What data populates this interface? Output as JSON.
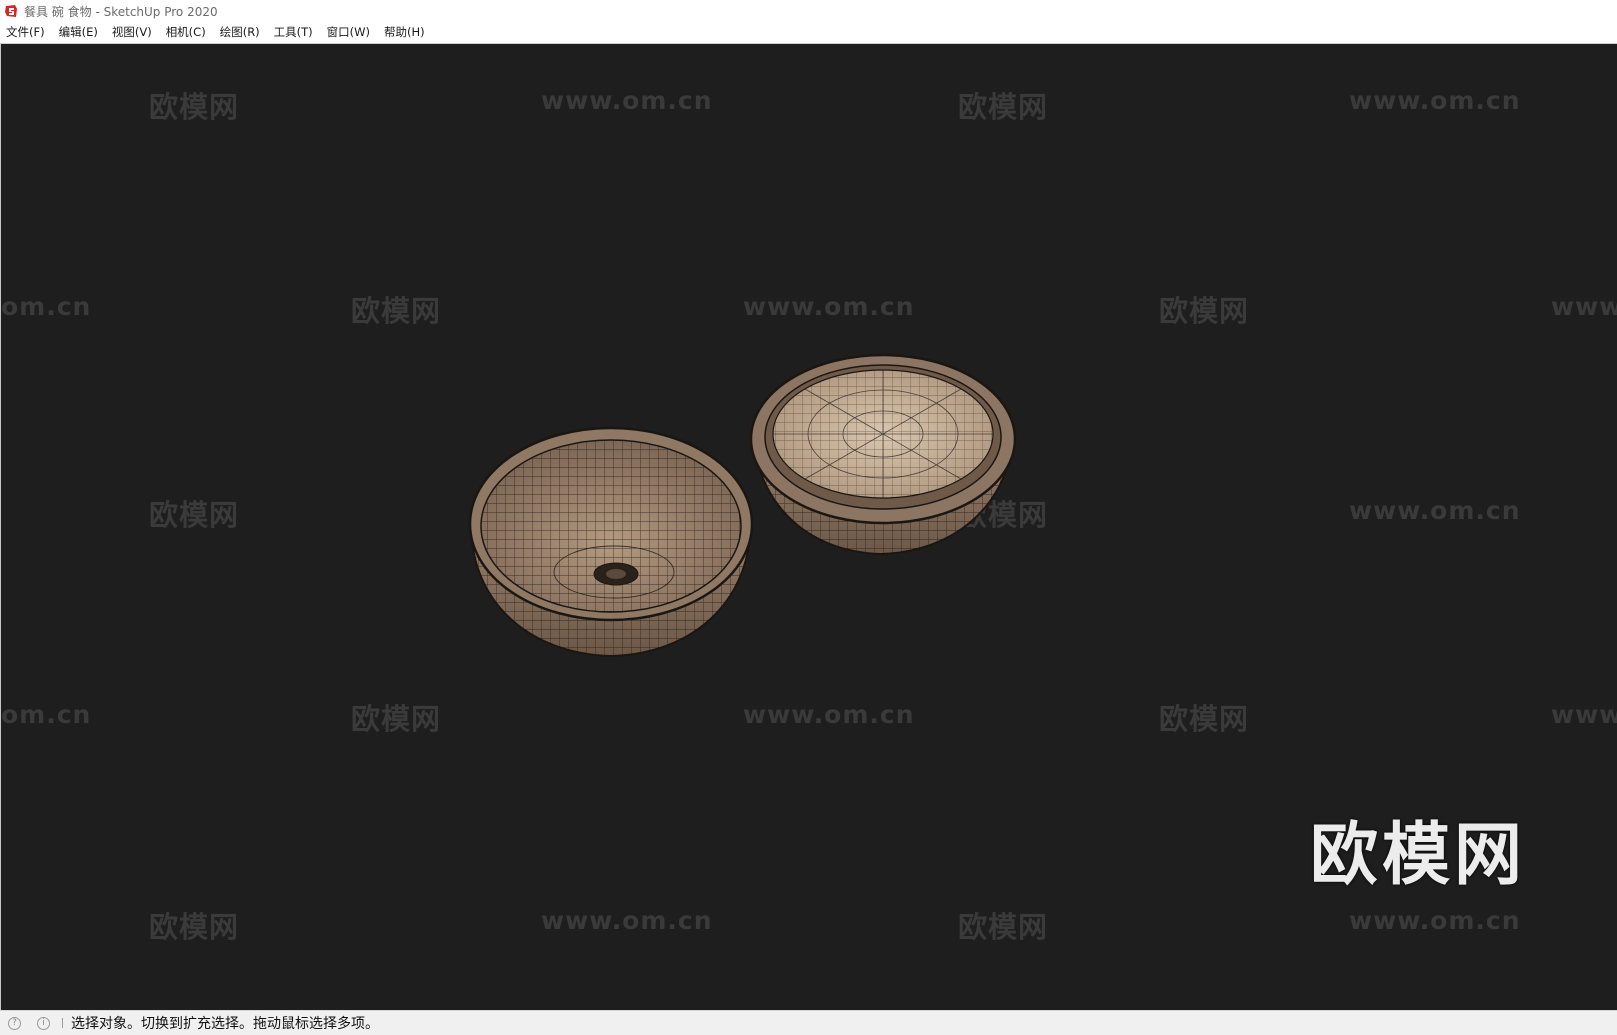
{
  "window": {
    "title": "餐具 碗 食物 - SketchUp Pro 2020",
    "app_icon": "sketchup-logo-icon"
  },
  "menu": [
    {
      "label": "文件(F)"
    },
    {
      "label": "编辑(E)"
    },
    {
      "label": "视图(V)"
    },
    {
      "label": "相机(C)"
    },
    {
      "label": "绘图(R)"
    },
    {
      "label": "工具(T)"
    },
    {
      "label": "窗口(W)"
    },
    {
      "label": "帮助(H)"
    }
  ],
  "viewport": {
    "background": "#1e1e1e",
    "scene": "two wireframe bowls, one empty, one containing food",
    "watermark_cn": "欧模网",
    "watermark_url": "www.om.cn",
    "watermark_om_cn": "om.cn",
    "watermark_www": "www.",
    "logo_watermark": "欧模网"
  },
  "status": {
    "geo_icon": "geo-location-icon",
    "info_icon": "info-icon",
    "text": "选择对象。切换到扩充选择。拖动鼠标选择多项。"
  },
  "colors": {
    "bowl_fill": "#8a7261",
    "bowl_inner": "#a3876f",
    "food_surface": "#c8b29a",
    "wire": "#1c1612"
  }
}
